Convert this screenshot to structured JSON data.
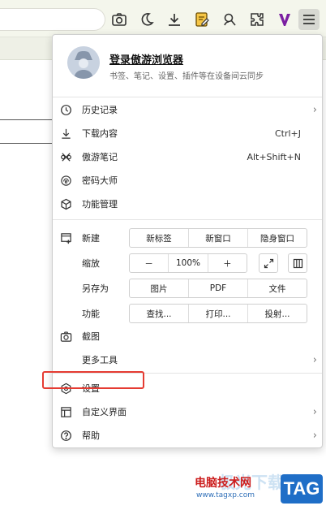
{
  "toolbar": {
    "icons": [
      "camera-icon",
      "night-mode-icon",
      "download-icon",
      "notes-icon",
      "password-icon",
      "extensions-icon",
      "v-icon",
      "menu-icon"
    ]
  },
  "menu": {
    "profile": {
      "title": "登录傲游浏览器",
      "subtitle": "书签、笔记、设置、插件等在设备间云同步"
    },
    "items": {
      "history": {
        "label": "历史记录"
      },
      "downloads": {
        "label": "下载内容",
        "shortcut": "Ctrl+J"
      },
      "notes": {
        "label": "傲游笔记",
        "shortcut": "Alt+Shift+N"
      },
      "password": {
        "label": "密码大师"
      },
      "extensions": {
        "label": "功能管理"
      },
      "new": {
        "label": "新建",
        "tab": "新标签",
        "window": "新窗口",
        "incognito": "隐身窗口"
      },
      "zoom": {
        "label": "缩放",
        "minus": "－",
        "value": "100%",
        "plus": "＋"
      },
      "saveas": {
        "label": "另存为",
        "image": "图片",
        "pdf": "PDF",
        "file": "文件"
      },
      "functions": {
        "label": "功能",
        "find": "查找...",
        "print": "打印...",
        "cast": "投射..."
      },
      "screenshot": {
        "label": "截图"
      },
      "more_tools": {
        "label": "更多工具"
      },
      "settings": {
        "label": "设置"
      },
      "customize": {
        "label": "自定义界面"
      },
      "help": {
        "label": "帮助"
      }
    },
    "arrow": "›"
  },
  "watermark": {
    "faded": "极光下载站",
    "name": "电脑技术网",
    "url": "www.tagxp.com",
    "tag": "TAG"
  },
  "colors": {
    "highlight": "#e53b32",
    "toolbar_bg": "#f4f6ec",
    "tag_bg": "#1f6ec7",
    "v_icon": "#7b1fa2"
  }
}
